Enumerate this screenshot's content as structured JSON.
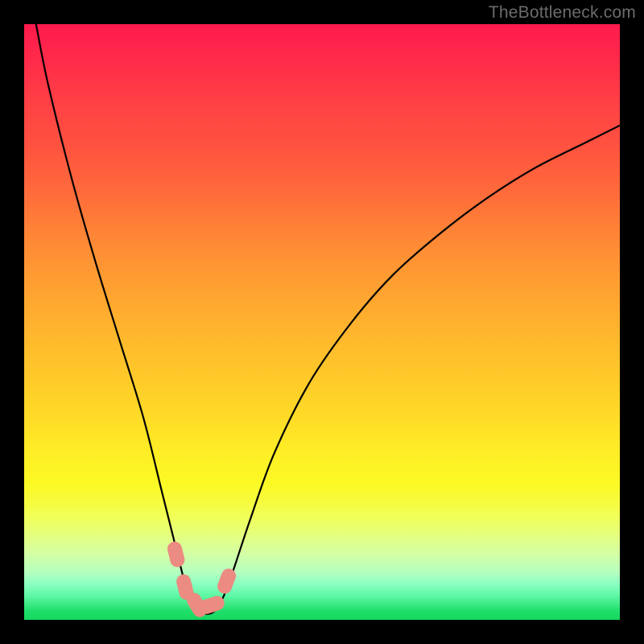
{
  "watermark": "TheBottleneck.com",
  "chart_data": {
    "type": "line",
    "title": "",
    "xlabel": "",
    "ylabel": "",
    "xlim": [
      0,
      100
    ],
    "ylim": [
      0,
      100
    ],
    "grid": false,
    "series": [
      {
        "name": "curve",
        "x": [
          2,
          4,
          8,
          12,
          16,
          20,
          23,
          25,
          26.5,
          27.5,
          29,
          30.5,
          32,
          33.5,
          35,
          38,
          42,
          48,
          55,
          62,
          70,
          78,
          86,
          94,
          100
        ],
        "values": [
          100,
          90,
          74,
          60,
          47,
          34,
          22,
          14,
          8,
          4,
          1.5,
          1,
          1.5,
          4,
          8,
          17,
          28,
          40,
          50,
          58,
          65,
          71,
          76,
          80,
          83
        ]
      }
    ],
    "markers": [
      {
        "x": 25.5,
        "y": 11
      },
      {
        "x": 27.0,
        "y": 5.5
      },
      {
        "x": 29.0,
        "y": 2.5
      },
      {
        "x": 31.5,
        "y": 2.5
      },
      {
        "x": 34.0,
        "y": 6.5
      }
    ],
    "marker_color": "#eb8b81",
    "curve_color": "#000000",
    "background_gradient": [
      "#ff1a4d",
      "#ffee26",
      "#15d75f"
    ]
  }
}
